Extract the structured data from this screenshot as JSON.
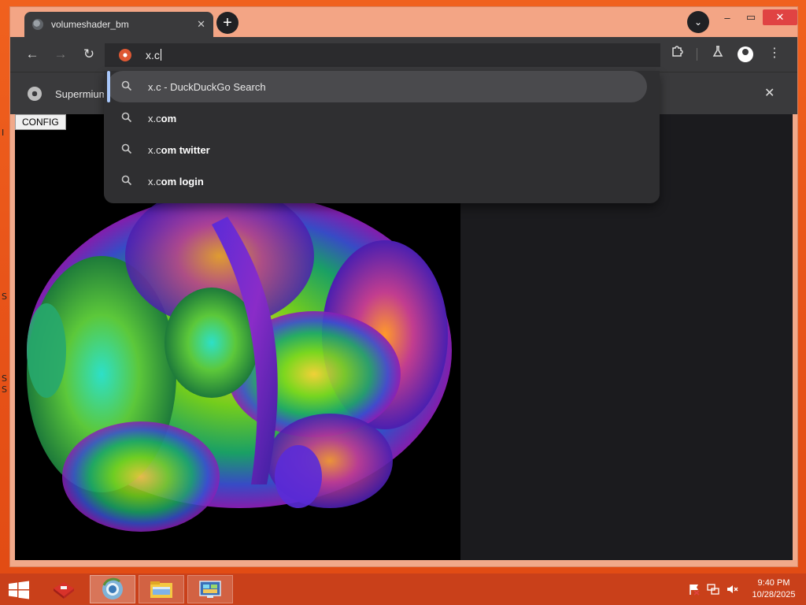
{
  "browser": {
    "tab_title": "volumeshader_bm",
    "tab_close": "✕",
    "new_tab": "+",
    "tab_search": "⌄",
    "window_controls": {
      "minimize": "–",
      "maximize": "▭",
      "close": "✕"
    },
    "address_value": "x.c",
    "infobar_text": "Supermium",
    "infobar_close": "✕",
    "nav": {
      "back": "←",
      "forward": "→",
      "reload": "↻"
    },
    "toolbar_icons": {
      "extensions": "puzzle-icon",
      "labs": "flask-icon",
      "profile": "profile-icon",
      "menu": "⋮"
    }
  },
  "omnibox_suggestions": [
    {
      "prefix": "x.c",
      "suffix": " - DuckDuckGo Search",
      "selected": true
    },
    {
      "prefix": "x.c",
      "suffix": "om",
      "selected": false
    },
    {
      "prefix": "x.c",
      "suffix": "om twitter",
      "selected": false
    },
    {
      "prefix": "x.c",
      "suffix": "om login",
      "selected": false
    }
  ],
  "page": {
    "config_label": "CONFIG"
  },
  "desktop": {
    "glyphs": [
      "I",
      "S",
      "S",
      "S"
    ]
  },
  "taskbar": {
    "apps": [
      "start-icon",
      "toolbox-icon",
      "browser-icon",
      "file-explorer-icon",
      "control-panel-icon"
    ],
    "time": "9:40 PM",
    "date": "10/28/2025"
  },
  "colors": {
    "wallpaper": "#e8541a",
    "taskbar": "#c9401a",
    "browser_chrome": "#3a3a3c",
    "omnibox_selected": "#4a4a4d",
    "selection_accent": "#a8c7fa",
    "close_button": "#e04343"
  }
}
